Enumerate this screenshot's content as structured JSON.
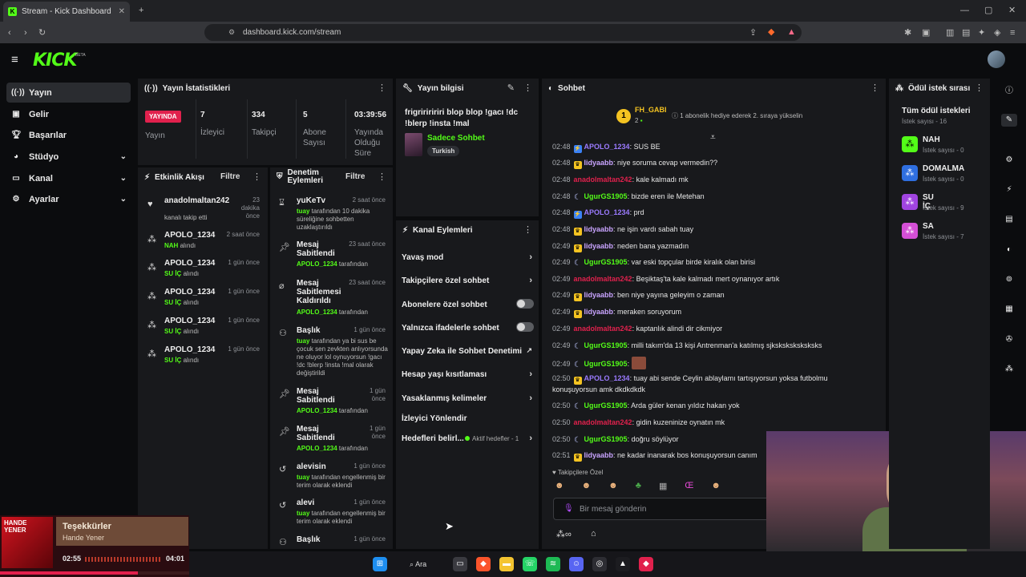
{
  "browser": {
    "tab_title": "Stream - Kick Dashboard",
    "url": "dashboard.kick.com/stream"
  },
  "app": {
    "logo": "KICK",
    "beta": "BETA"
  },
  "sidebar": {
    "items": [
      {
        "label": "Yayın",
        "icon": "broadcast-icon"
      },
      {
        "label": "Gelir",
        "icon": "money-icon"
      },
      {
        "label": "Başarılar",
        "icon": "trophy-icon"
      },
      {
        "label": "Stüdyo",
        "icon": "palette-icon"
      },
      {
        "label": "Kanal",
        "icon": "channel-icon"
      },
      {
        "label": "Ayarlar",
        "icon": "gear-icon"
      }
    ]
  },
  "stats": {
    "title": "Yayın İstatistikleri",
    "live_badge": "YAYINDA",
    "live_label": "Yayın",
    "viewers_value": "7",
    "viewers_label": "İzleyici",
    "followers_value": "334",
    "followers_label": "Takipçi",
    "subs_value": "5",
    "subs_label": "Abone Sayısı",
    "duration_value": "03:39:56",
    "duration_label": "Yayında Olduğu Süre"
  },
  "stream_info": {
    "title": "Yayın bilgisi",
    "stream_title": "frigririririri blop blop !gacı !dc !blerp !insta !mal",
    "category": "Sadece Sohbet",
    "tag": "Turkish"
  },
  "activity": {
    "title": "Etkinlik Akışı",
    "filter": "Filtre",
    "rows": [
      {
        "name": "anadolmaltan242",
        "time": "23 dakika önce",
        "sub_a": "kanalı takip etti",
        "sub_b": ""
      },
      {
        "name": "APOLO_1234",
        "time": "2 saat önce",
        "sub_a": "NAH",
        "sub_b": " alındı"
      },
      {
        "name": "APOLO_1234",
        "time": "1 gün önce",
        "sub_a": "SU İÇ",
        "sub_b": " alındı"
      },
      {
        "name": "APOLO_1234",
        "time": "1 gün önce",
        "sub_a": "SU İÇ",
        "sub_b": " alındı"
      },
      {
        "name": "APOLO_1234",
        "time": "1 gün önce",
        "sub_a": "SU İÇ",
        "sub_b": " alındı"
      },
      {
        "name": "APOLO_1234",
        "time": "1 gün önce",
        "sub_a": "SU İÇ",
        "sub_b": " alındı"
      }
    ]
  },
  "moderation": {
    "title": "Denetim Eylemleri",
    "filter": "Filtre",
    "rows": [
      {
        "title": "yuKeTv",
        "time": "2 saat önce",
        "user": "tuay",
        "text": " tarafından 10 dakika süreliğine sohbetten uzaklaştırıldı"
      },
      {
        "title": "Mesaj Sabitlendi",
        "time": "23 saat önce",
        "user": "APOLO_1234",
        "text": " tarafından"
      },
      {
        "title": "Mesaj Sabitlemesi Kaldırıldı",
        "time": "23 saat önce",
        "user": "APOLO_1234",
        "text": " tarafından"
      },
      {
        "title": "Başlık",
        "time": "1 gün önce",
        "user": "tuay",
        "text": " tarafından ya bi sus be çocuk sen zevkten anlıyorsunda ne oluyor lol oynuyorsun !gacı !dc !blerp !insta !mal olarak değiştirildi"
      },
      {
        "title": "Mesaj Sabitlendi",
        "time": "1 gün önce",
        "user": "APOLO_1234",
        "text": " tarafından"
      },
      {
        "title": "Mesaj Sabitlendi",
        "time": "1 gün önce",
        "user": "APOLO_1234",
        "text": " tarafından"
      },
      {
        "title": "alevisin",
        "time": "1 gün önce",
        "user": "tuay",
        "text": " tarafından engellenmiş bir terim olarak eklendi"
      },
      {
        "title": "alevi",
        "time": "1 gün önce",
        "user": "tuay",
        "text": " tarafından engellenmiş bir terim olarak eklendi"
      },
      {
        "title": "Başlık",
        "time": "1 gün önce",
        "user": "",
        "text": ""
      }
    ]
  },
  "channel_actions": {
    "title": "Kanal Eylemleri",
    "items": [
      {
        "label": "Yavaş mod"
      },
      {
        "label": "Takipçilere özel sohbet"
      },
      {
        "label": "Abonelere özel sohbet"
      },
      {
        "label": "Yalnızca ifadelerle sohbet"
      },
      {
        "label": "Yapay Zeka ile Sohbet Denetimi"
      },
      {
        "label": "Hesap yaşı kısıtlaması"
      },
      {
        "label": "Yasaklanmış kelimeler"
      },
      {
        "label": "İzleyici Yönlendir"
      },
      {
        "label": "Hedefleri belirl..."
      }
    ],
    "goals_badge": "Aktif hedefler - 1"
  },
  "chat": {
    "title": "Sohbet",
    "top_gifter": "FH_GABI",
    "top_gifter_count": "2",
    "gift_note": "1 abonelik hediye ederek 2. sıraya yükselin",
    "messages": [
      {
        "time": "02:48",
        "user": "APOLO_1234",
        "text": ": SUS BE",
        "color": "#9b7bff",
        "badge": "blue"
      },
      {
        "time": "02:48",
        "user": "lidyaabb",
        "text": ": niye soruma cevap vermedin??",
        "color": "#c9a4ff",
        "badge": "gold"
      },
      {
        "time": "02:48",
        "user": "anadolmaltan242",
        "text": ": kale kalmadı mk",
        "color": "#e1214d",
        "badge": ""
      },
      {
        "time": "02:48",
        "user": "UgurGS1905",
        "text": ": bizde eren ile Metehan",
        "color": "#53fc18",
        "badge": "moon"
      },
      {
        "time": "02:48",
        "user": "APOLO_1234",
        "text": ": prd",
        "color": "#9b7bff",
        "badge": "blue"
      },
      {
        "time": "02:48",
        "user": "lidyaabb",
        "text": ": ne işin vardı sabah tuay",
        "color": "#c9a4ff",
        "badge": "gold"
      },
      {
        "time": "02:49",
        "user": "lidyaabb",
        "text": ": neden bana yazmadın",
        "color": "#c9a4ff",
        "badge": "gold"
      },
      {
        "time": "02:49",
        "user": "UgurGS1905",
        "text": ": var eski topçular birde kiralık olan birisi",
        "color": "#53fc18",
        "badge": "moon"
      },
      {
        "time": "02:49",
        "user": "anadolmaltan242",
        "text": ": Beşiktaş'ta kale kalmadı mert oynanıyor artık",
        "color": "#e1214d",
        "badge": ""
      },
      {
        "time": "02:49",
        "user": "lidyaabb",
        "text": ": ben niye yayına geleyim o zaman",
        "color": "#c9a4ff",
        "badge": "gold"
      },
      {
        "time": "02:49",
        "user": "lidyaabb",
        "text": ": meraken soruyorum",
        "color": "#c9a4ff",
        "badge": "gold"
      },
      {
        "time": "02:49",
        "user": "anadolmaltan242",
        "text": ": kaptanlık alindi dir cikmiyor",
        "color": "#e1214d",
        "badge": ""
      },
      {
        "time": "02:49",
        "user": "UgurGS1905",
        "text": ": milli takım'da 13 kişi Antrenman'a katılmış sjksksksksksksks",
        "color": "#53fc18",
        "badge": "moon"
      },
      {
        "time": "02:49",
        "user": "UgurGS1905",
        "text": ":",
        "color": "#53fc18",
        "badge": "moon"
      },
      {
        "time": "02:50",
        "user": "APOLO_1234",
        "text": ": tuay abi sende Ceylin ablaylamı tartışıyorsun yoksa futbolmu",
        "color": "#9b7bff",
        "badge": "gold"
      },
      {
        "time": "",
        "user": "",
        "text": "konuşuyorsun amk dkdkdkdk",
        "color": "#e6e6e6",
        "badge": ""
      },
      {
        "time": "02:50",
        "user": "UgurGS1905",
        "text": ": Arda güler kenan yıldız hakan yok",
        "color": "#53fc18",
        "badge": "moon"
      },
      {
        "time": "02:50",
        "user": "anadolmaltan242",
        "text": ": gidin kuzeninize oynatın mk",
        "color": "#e1214d",
        "badge": ""
      },
      {
        "time": "02:50",
        "user": "UgurGS1905",
        "text": ": doğru söylüyor",
        "color": "#53fc18",
        "badge": "moon"
      },
      {
        "time": "02:51",
        "user": "lidyaabb",
        "text": ": ne kadar inanarak bos konuşuyorsun canım",
        "color": "#c9a4ff",
        "badge": "gold"
      }
    ],
    "emote_section": "Takipçilere Özel",
    "input_placeholder": "Bir mesaj gönderin"
  },
  "rewards": {
    "title": "Ödül istek sırası",
    "all_label": "Tüm ödül istekleri",
    "all_count": "İstek sayısı - 16",
    "items": [
      {
        "name": "NAH",
        "count": "İstek sayısı - 0",
        "color": "#53fc18"
      },
      {
        "name": "DOMALMA",
        "count": "İstek sayısı - 0",
        "color": "#2f6fe0"
      },
      {
        "name": "SU İÇ",
        "count": "İstek sayısı - 9",
        "color": "#a044e0"
      },
      {
        "name": "SA",
        "count": "İstek sayısı - 7",
        "color": "#d44fd6"
      }
    ]
  },
  "music": {
    "title": "Teşekkürler",
    "artist": "Hande Yener",
    "elapsed": "02:55",
    "total": "04:01",
    "progress": 0.73,
    "cover_text": "HANDE YENER"
  },
  "taskbar": {
    "search": "Ara"
  }
}
